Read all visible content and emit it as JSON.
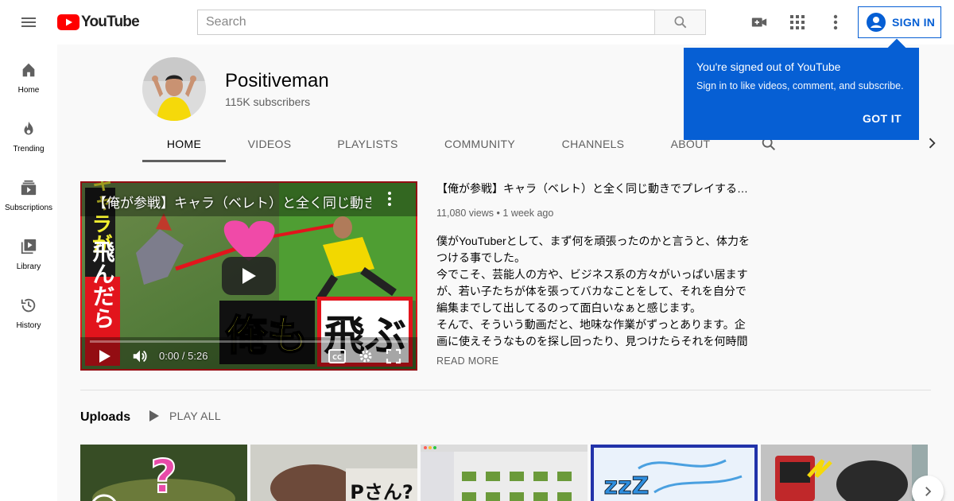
{
  "header": {
    "logo_text": "YouTube",
    "search_placeholder": "Search",
    "signin_label": "SIGN IN"
  },
  "sidebar": {
    "items": [
      {
        "label": "Home",
        "icon": "home-icon"
      },
      {
        "label": "Trending",
        "icon": "flame-icon"
      },
      {
        "label": "Subscriptions",
        "icon": "subscriptions-icon"
      },
      {
        "label": "Library",
        "icon": "library-icon"
      },
      {
        "label": "History",
        "icon": "history-icon"
      }
    ]
  },
  "channel": {
    "name": "Positiveman",
    "subscribers": "115K subscribers",
    "tabs": [
      "HOME",
      "VIDEOS",
      "PLAYLISTS",
      "COMMUNITY",
      "CHANNELS",
      "ABOUT"
    ],
    "active_tab": "HOME"
  },
  "popup": {
    "title": "You're signed out of YouTube",
    "body": "Sign in to like videos, comment, and subscribe.",
    "button": "GOT IT"
  },
  "featured": {
    "player_title": "【俺が参戦】キャラ（ベレト）と全く同じ動きでプレイする…",
    "title": "【俺が参戦】キャラ（ベレト）と全く同じ動きでプレイする…",
    "time": "0:00 / 5:26",
    "views": "11,080 views",
    "age": "1 week ago",
    "description": [
      "僕がYouTuberとして、まず何を頑張ったのかと言うと、体力を",
      "つける事でした。",
      "今でこそ、芸能人の方や、ビジネス系の方々がいっぱい居ます",
      "が、若い子たちが体を張ってバカなことをして、それを自分で",
      "編集までして出してるのって面白いなぁと感じます。",
      "そんで、そういう動画だと、地味な作業がずっとあります。企",
      "画に使えそうなものを探し回ったり、見つけたらそれを何時間"
    ],
    "read_more": "READ MORE",
    "thumbnail_text": {
      "vertical_top": "キャラが",
      "vertical_bottom": "飛んだら",
      "big_left": "俺も",
      "big_right": "飛ぶ"
    }
  },
  "uploads": {
    "title": "Uploads",
    "play_all": "PLAY ALL",
    "thumb_labels": [
      "?",
      "Pさん?",
      "",
      "zzZ",
      ""
    ]
  },
  "colors": {
    "accent_blue": "#065fd4",
    "youtube_red": "#ff0000"
  }
}
